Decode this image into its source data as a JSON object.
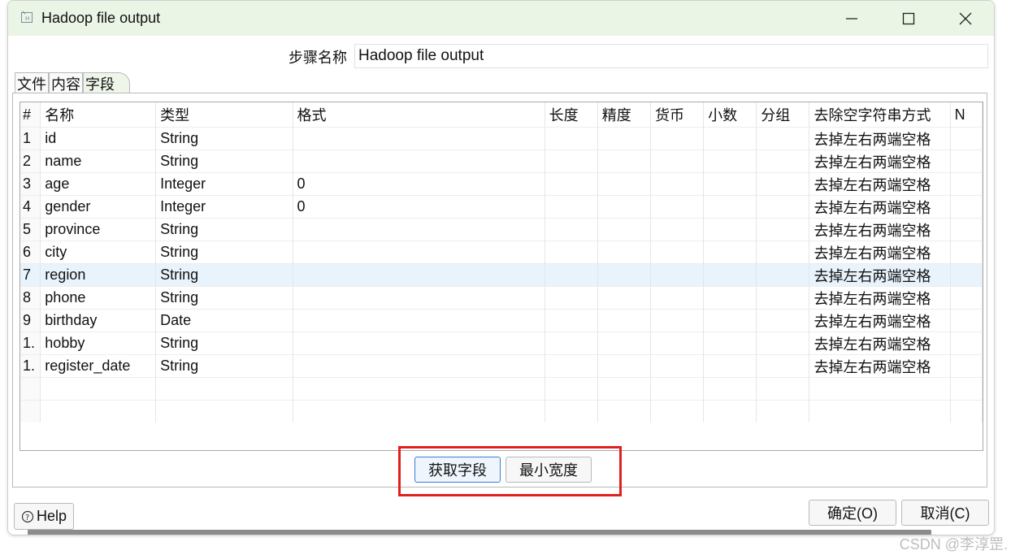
{
  "window": {
    "title": "Hadoop file output"
  },
  "step": {
    "label": "步骤名称",
    "value": "Hadoop file output"
  },
  "tabs": [
    {
      "label": "文件"
    },
    {
      "label": "内容"
    },
    {
      "label": "字段"
    }
  ],
  "grid": {
    "columns": [
      "#",
      "名称",
      "类型",
      "格式",
      "长度",
      "精度",
      "货币",
      "小数",
      "分组",
      "去除空字符串方式",
      "N"
    ],
    "rows": [
      {
        "num": "1",
        "name": "id",
        "type": "String",
        "format": "",
        "trim": "去掉左右两端空格"
      },
      {
        "num": "2",
        "name": "name",
        "type": "String",
        "format": "",
        "trim": "去掉左右两端空格"
      },
      {
        "num": "3",
        "name": "age",
        "type": "Integer",
        "format": "0",
        "trim": "去掉左右两端空格"
      },
      {
        "num": "4",
        "name": "gender",
        "type": "Integer",
        "format": "0",
        "trim": "去掉左右两端空格"
      },
      {
        "num": "5",
        "name": "province",
        "type": "String",
        "format": "",
        "trim": "去掉左右两端空格"
      },
      {
        "num": "6",
        "name": "city",
        "type": "String",
        "format": "",
        "trim": "去掉左右两端空格"
      },
      {
        "num": "7",
        "name": "region",
        "type": "String",
        "format": "",
        "trim": "去掉左右两端空格"
      },
      {
        "num": "8",
        "name": "phone",
        "type": "String",
        "format": "",
        "trim": "去掉左右两端空格"
      },
      {
        "num": "9",
        "name": "birthday",
        "type": "Date",
        "format": "",
        "trim": "去掉左右两端空格"
      },
      {
        "num": "1.",
        "name": "hobby",
        "type": "String",
        "format": "",
        "trim": "去掉左右两端空格"
      },
      {
        "num": "1.",
        "name": "register_date",
        "type": "String",
        "format": "",
        "trim": "去掉左右两端空格"
      }
    ],
    "selected_row": "7"
  },
  "buttons": {
    "get_fields": "获取字段",
    "min_width": "最小宽度",
    "help": "Help",
    "ok": "确定(O)",
    "cancel": "取消(C)"
  },
  "watermark": "CSDN @李淳罡."
}
